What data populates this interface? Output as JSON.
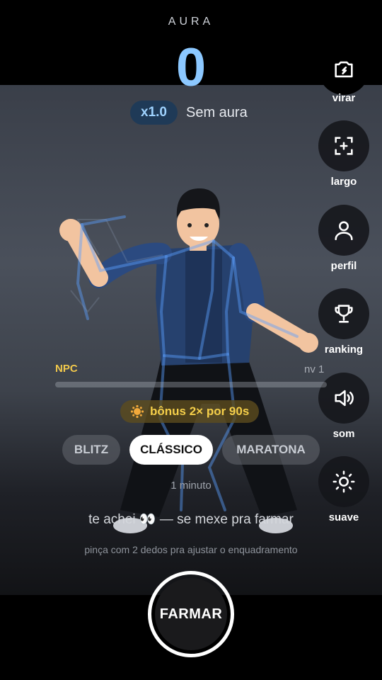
{
  "header": {
    "aura_label": "AURA",
    "aura_score": "0",
    "multiplier": "x1.0",
    "aura_status": "Sem aura"
  },
  "side_menu": {
    "flip_label": "virar",
    "wide_label": "largo",
    "profile_label": "perfil",
    "ranking_label": "ranking",
    "sound_label": "som",
    "smooth_label": "suave"
  },
  "level": {
    "rank": "NPC",
    "level": "nv 1",
    "progress": 0
  },
  "bonus": {
    "text": "bônus 2× por 90s",
    "icon": "sun-icon"
  },
  "modes": {
    "blitz": "BLITZ",
    "classic": "CLÁSSICO",
    "marathon": "MARATONA",
    "selected": "CLÁSSICO",
    "duration": "1 minuto"
  },
  "hints": {
    "detected": "te achei 👀 — se mexe pra farmar",
    "pinch": "pinça com 2 dedos pra ajustar o enquadramento"
  },
  "farm_button": "FARMAR",
  "colors": {
    "accent_blue": "#8cc8ff",
    "gold": "#f2c94c",
    "skeleton": "#5aa0ff"
  }
}
